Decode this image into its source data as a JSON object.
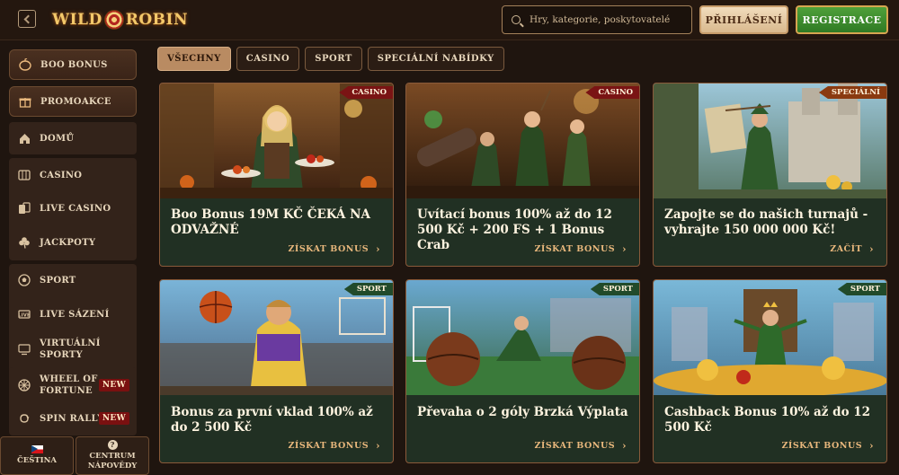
{
  "header": {
    "logo_text_left": "WILD",
    "logo_text_right": "ROBIN",
    "search_placeholder": "Hry, kategorie, poskytovatelé",
    "login_label": "PŘIHLÁŠENÍ",
    "register_label": "REGISTRACE"
  },
  "sidebar": {
    "items": [
      {
        "label": "BOO BONUS",
        "icon": "pumpkin-icon"
      },
      {
        "label": "PROMOAKCE",
        "icon": "gift-icon"
      },
      {
        "label": "DOMŮ",
        "icon": "home-icon"
      },
      {
        "label": "CASINO",
        "icon": "slot-icon"
      },
      {
        "label": "LIVE CASINO",
        "icon": "cards-icon"
      },
      {
        "label": "JACKPOTY",
        "icon": "clover-icon"
      },
      {
        "label": "SPORT",
        "icon": "football-icon"
      },
      {
        "label": "LIVE SÁZENÍ",
        "icon": "live-icon"
      },
      {
        "label": "VIRTUÁLNÍ SPORTY",
        "line1": "VIRTUÁLNÍ",
        "line2": "SPORTY",
        "icon": "virtual-icon"
      },
      {
        "label": "WHEEL OF FORTUNE",
        "line1": "WHEEL OF",
        "line2": "FORTUNE",
        "icon": "wheel-icon",
        "badge": "NEW"
      },
      {
        "label": "SPIN RALLY",
        "icon": "spin-icon",
        "badge": "NEW"
      }
    ],
    "language": "ČEŠTINA",
    "help_line1": "CENTRUM",
    "help_line2": "NÁPOVĚDY"
  },
  "tabs": [
    "VŠECHNY",
    "CASINO",
    "SPORT",
    "SPECIÁLNÍ NABÍDKY"
  ],
  "active_tab": "VŠECHNY",
  "cards": [
    {
      "ribbon": "CASINO",
      "title": "Boo Bonus 19M KČ ČEKÁ NA ODVAŽNÉ",
      "cta": "ZÍSKAT BONUS"
    },
    {
      "ribbon": "CASINO",
      "title": "Uvítací bonus 100% až do 12 500 Kč + 200 FS + 1 Bonus Crab",
      "cta": "ZÍSKAT BONUS"
    },
    {
      "ribbon": "SPECIÁLNÍ",
      "title": "Zapojte se do našich turnajů - vyhrajte 150 000 000 Kč!",
      "cta": "ZAČÍT"
    },
    {
      "ribbon": "SPORT",
      "title": "Bonus za první vklad 100% až do 2 500 Kč",
      "cta": "ZÍSKAT BONUS"
    },
    {
      "ribbon": "SPORT",
      "title": "Převaha o 2 góly Brzká Výplata",
      "cta": "ZÍSKAT BONUS"
    },
    {
      "ribbon": "SPORT",
      "title": "Cashback Bonus 10% až do 12 500 Kč",
      "cta": "ZÍSKAT BONUS"
    }
  ],
  "colors": {
    "background": "#1f150f",
    "accent_gold": "#e8b77c",
    "register_green": "#3a8a2d",
    "card_green": "#213023",
    "badge_red": "#7a1010"
  }
}
